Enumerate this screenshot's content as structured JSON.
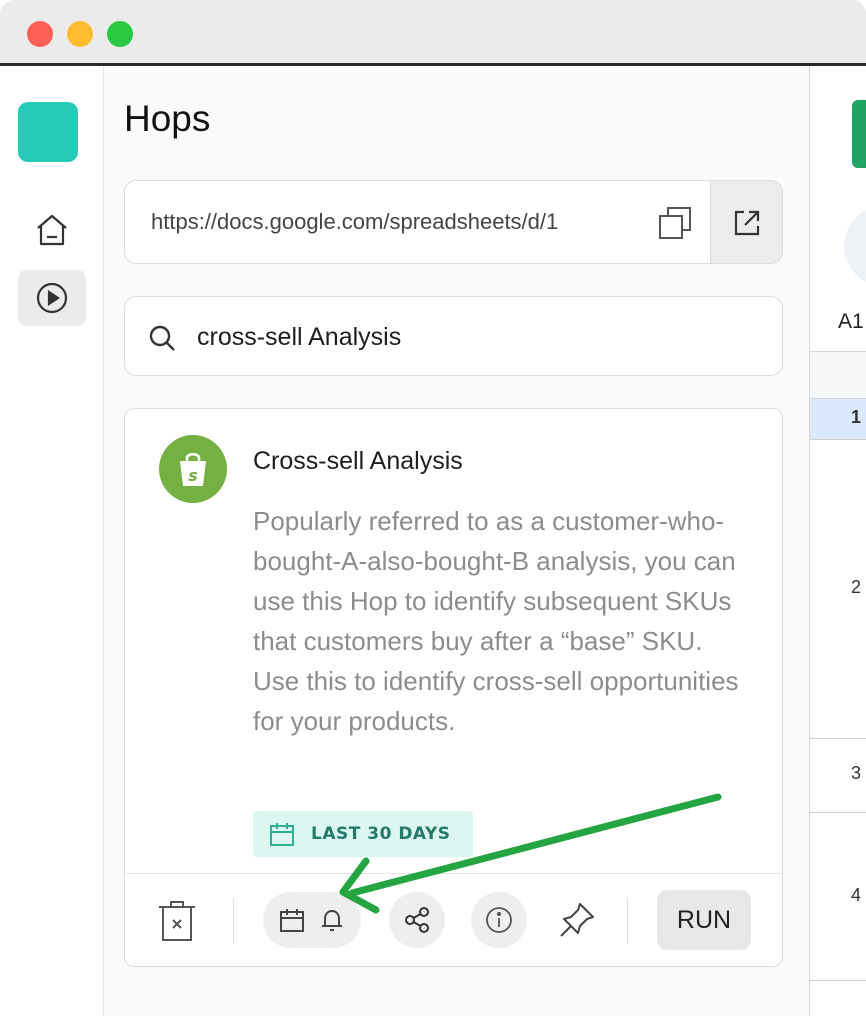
{
  "window": {
    "controls": [
      "close",
      "minimize",
      "zoom"
    ]
  },
  "rail": {
    "items": [
      {
        "icon": "home-icon",
        "active": false
      },
      {
        "icon": "play-circle-icon",
        "active": true
      }
    ],
    "logo_color": "#26cbb7"
  },
  "header": {
    "title": "Hops"
  },
  "url_bar": {
    "value": "https://docs.google.com/spreadsheets/d/1",
    "copy_icon": "copy-icon",
    "open_icon": "open-external-icon"
  },
  "search": {
    "value": "cross-sell Analysis",
    "icon": "search-icon"
  },
  "hop_card": {
    "logo_icon": "shopify-bag-icon",
    "logo_color": "#75b043",
    "title": "Cross-sell Analysis",
    "description": "Popularly referred to as a customer-who-bought-A-also-bought-B analysis, you can use this Hop to identify subsequent SKUs that customers buy after a “base” SKU. Use this to identify cross-sell opportunities for your products.",
    "badge": {
      "label": "LAST 30 DAYS",
      "icon": "calendar-icon",
      "color": "#237a6b",
      "background": "#dcf7f1"
    },
    "actions": {
      "delete_icon": "trash-icon",
      "schedule_icons": [
        "calendar-icon",
        "bell-icon"
      ],
      "share_icon": "share-icon",
      "info_icon": "info-icon",
      "pin_icon": "pin-icon",
      "run_label": "RUN"
    }
  },
  "annotation": {
    "arrow_color": "#25a541",
    "points_to": "schedule-button"
  },
  "sheet": {
    "cell_ref": "A1",
    "rows": [
      {
        "label": "1",
        "selected": true
      },
      {
        "label": "2"
      },
      {
        "label": "3"
      },
      {
        "label": "4"
      }
    ],
    "brand_color": "#1fa463"
  }
}
